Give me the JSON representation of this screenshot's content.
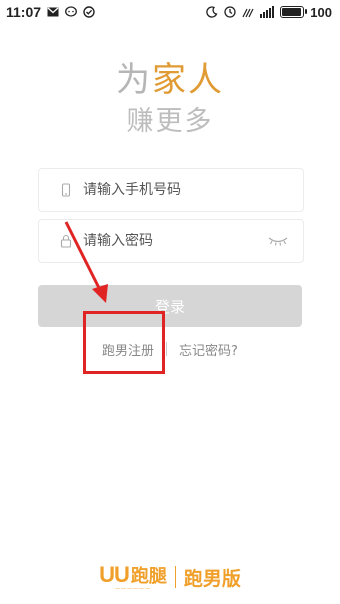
{
  "status_bar": {
    "time": "11:07",
    "battery": "100",
    "battery_level": 1.0
  },
  "slogan": {
    "line1_part1": "为",
    "line1_part2": "家人",
    "line2": "赚更多"
  },
  "form": {
    "phone_placeholder": "请输入手机号码",
    "password_placeholder": "请输入密码",
    "login_label": "登录"
  },
  "links": {
    "register": "跑男注册",
    "forgot": "忘记密码?"
  },
  "footer": {
    "brand_name": "跑腿",
    "brand_edition": "跑男版"
  },
  "colors": {
    "accent_orange": "#e09b34",
    "annotation_red": "#e02424",
    "button_disabled": "#d6d6d6"
  },
  "icons": {
    "phone": "phone-icon",
    "lock": "lock-icon",
    "eye": "eye-closed-icon"
  }
}
